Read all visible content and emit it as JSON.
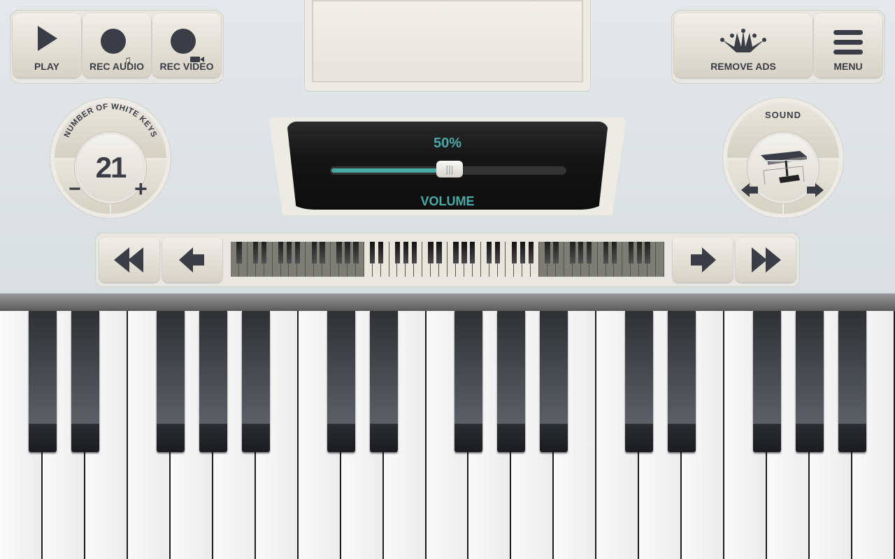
{
  "toolbar_left": {
    "play": "PLAY",
    "rec_audio": "REC AUDIO",
    "rec_video": "REC VIDEO"
  },
  "toolbar_right": {
    "remove_ads": "REMOVE ADS",
    "menu": "MENU"
  },
  "white_keys_dial": {
    "label": "NUMBER OF WHITE KEYS",
    "value": "21",
    "minus": "−",
    "plus": "+"
  },
  "volume": {
    "percent_label": "50%",
    "value": 50,
    "label": "VOLUME",
    "accent": "#4aa9a4"
  },
  "sound_dial": {
    "label": "SOUND",
    "icon": "keyboard-stand-icon"
  },
  "keyboard": {
    "white_key_count": 21,
    "mini_white_key_count": 52
  },
  "colors": {
    "icon": "#3a3d45",
    "panel": "#e8e7e2",
    "black_key": "#2e3034"
  }
}
